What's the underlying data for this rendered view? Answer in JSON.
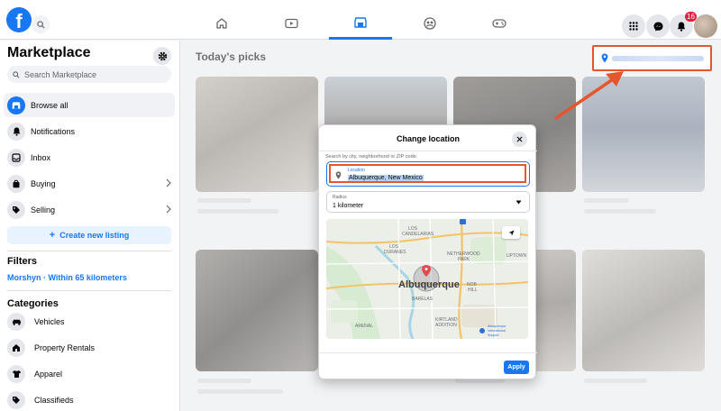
{
  "search": {
    "placeholder": "Search Marketplace"
  },
  "sidebar": {
    "title": "Marketplace",
    "items": [
      {
        "label": "Browse all",
        "icon": "storefront-icon",
        "active": true
      },
      {
        "label": "Notifications",
        "icon": "bell-icon"
      },
      {
        "label": "Inbox",
        "icon": "inbox-icon"
      },
      {
        "label": "Buying",
        "icon": "bag-icon",
        "chevron": true
      },
      {
        "label": "Selling",
        "icon": "tag-icon",
        "chevron": true
      }
    ],
    "create_label": "Create new listing",
    "filters_title": "Filters",
    "filter_location": "Morshyn · Within 65 kilometers",
    "categories_title": "Categories",
    "categories": [
      {
        "label": "Vehicles",
        "icon": "car-icon"
      },
      {
        "label": "Property Rentals",
        "icon": "house-icon"
      },
      {
        "label": "Apparel",
        "icon": "shirt-icon"
      },
      {
        "label": "Classifieds",
        "icon": "tag-icon"
      }
    ]
  },
  "header": {
    "notification_count": "16"
  },
  "main": {
    "title": "Today's picks"
  },
  "modal": {
    "title": "Change location",
    "hint": "Search by city, neighborhood or ZIP code.",
    "location_label": "Location",
    "location_value": "Albuquerque, New Mexico",
    "radius_label": "Radius",
    "radius_value": "1 kilometer",
    "apply_label": "Apply",
    "map": {
      "center_label": "Albuquerque",
      "labels": [
        "LOS",
        "CANDELARIAS",
        "LOS",
        "DURANES",
        "NETHERWOOD",
        "PARK",
        "UPTOWN",
        "NOB",
        "HILL",
        "BARELAS",
        "ARENAL",
        "KIRTLAND",
        "ADDITION",
        "Albuquerque",
        "International",
        "Sunport"
      ]
    }
  },
  "colors": {
    "accent": "#1877f2",
    "highlight": "#e4572e"
  }
}
